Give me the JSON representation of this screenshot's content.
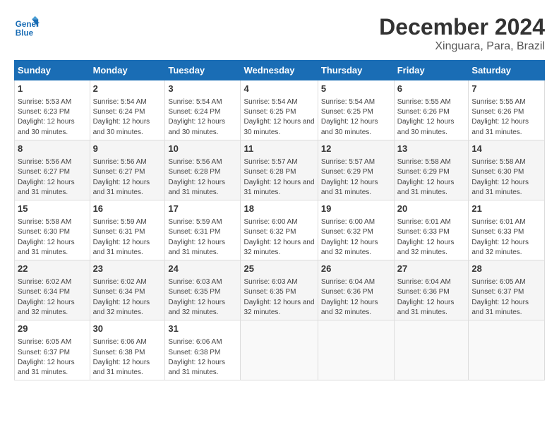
{
  "header": {
    "logo_line1": "General",
    "logo_line2": "Blue",
    "month": "December 2024",
    "location": "Xinguara, Para, Brazil"
  },
  "columns": [
    "Sunday",
    "Monday",
    "Tuesday",
    "Wednesday",
    "Thursday",
    "Friday",
    "Saturday"
  ],
  "weeks": [
    [
      {
        "day": "1",
        "sunrise": "5:53 AM",
        "sunset": "6:23 PM",
        "daylight": "12 hours and 30 minutes."
      },
      {
        "day": "2",
        "sunrise": "5:54 AM",
        "sunset": "6:24 PM",
        "daylight": "12 hours and 30 minutes."
      },
      {
        "day": "3",
        "sunrise": "5:54 AM",
        "sunset": "6:24 PM",
        "daylight": "12 hours and 30 minutes."
      },
      {
        "day": "4",
        "sunrise": "5:54 AM",
        "sunset": "6:25 PM",
        "daylight": "12 hours and 30 minutes."
      },
      {
        "day": "5",
        "sunrise": "5:54 AM",
        "sunset": "6:25 PM",
        "daylight": "12 hours and 30 minutes."
      },
      {
        "day": "6",
        "sunrise": "5:55 AM",
        "sunset": "6:26 PM",
        "daylight": "12 hours and 30 minutes."
      },
      {
        "day": "7",
        "sunrise": "5:55 AM",
        "sunset": "6:26 PM",
        "daylight": "12 hours and 31 minutes."
      }
    ],
    [
      {
        "day": "8",
        "sunrise": "5:56 AM",
        "sunset": "6:27 PM",
        "daylight": "12 hours and 31 minutes."
      },
      {
        "day": "9",
        "sunrise": "5:56 AM",
        "sunset": "6:27 PM",
        "daylight": "12 hours and 31 minutes."
      },
      {
        "day": "10",
        "sunrise": "5:56 AM",
        "sunset": "6:28 PM",
        "daylight": "12 hours and 31 minutes."
      },
      {
        "day": "11",
        "sunrise": "5:57 AM",
        "sunset": "6:28 PM",
        "daylight": "12 hours and 31 minutes."
      },
      {
        "day": "12",
        "sunrise": "5:57 AM",
        "sunset": "6:29 PM",
        "daylight": "12 hours and 31 minutes."
      },
      {
        "day": "13",
        "sunrise": "5:58 AM",
        "sunset": "6:29 PM",
        "daylight": "12 hours and 31 minutes."
      },
      {
        "day": "14",
        "sunrise": "5:58 AM",
        "sunset": "6:30 PM",
        "daylight": "12 hours and 31 minutes."
      }
    ],
    [
      {
        "day": "15",
        "sunrise": "5:58 AM",
        "sunset": "6:30 PM",
        "daylight": "12 hours and 31 minutes."
      },
      {
        "day": "16",
        "sunrise": "5:59 AM",
        "sunset": "6:31 PM",
        "daylight": "12 hours and 31 minutes."
      },
      {
        "day": "17",
        "sunrise": "5:59 AM",
        "sunset": "6:31 PM",
        "daylight": "12 hours and 31 minutes."
      },
      {
        "day": "18",
        "sunrise": "6:00 AM",
        "sunset": "6:32 PM",
        "daylight": "12 hours and 32 minutes."
      },
      {
        "day": "19",
        "sunrise": "6:00 AM",
        "sunset": "6:32 PM",
        "daylight": "12 hours and 32 minutes."
      },
      {
        "day": "20",
        "sunrise": "6:01 AM",
        "sunset": "6:33 PM",
        "daylight": "12 hours and 32 minutes."
      },
      {
        "day": "21",
        "sunrise": "6:01 AM",
        "sunset": "6:33 PM",
        "daylight": "12 hours and 32 minutes."
      }
    ],
    [
      {
        "day": "22",
        "sunrise": "6:02 AM",
        "sunset": "6:34 PM",
        "daylight": "12 hours and 32 minutes."
      },
      {
        "day": "23",
        "sunrise": "6:02 AM",
        "sunset": "6:34 PM",
        "daylight": "12 hours and 32 minutes."
      },
      {
        "day": "24",
        "sunrise": "6:03 AM",
        "sunset": "6:35 PM",
        "daylight": "12 hours and 32 minutes."
      },
      {
        "day": "25",
        "sunrise": "6:03 AM",
        "sunset": "6:35 PM",
        "daylight": "12 hours and 32 minutes."
      },
      {
        "day": "26",
        "sunrise": "6:04 AM",
        "sunset": "6:36 PM",
        "daylight": "12 hours and 32 minutes."
      },
      {
        "day": "27",
        "sunrise": "6:04 AM",
        "sunset": "6:36 PM",
        "daylight": "12 hours and 31 minutes."
      },
      {
        "day": "28",
        "sunrise": "6:05 AM",
        "sunset": "6:37 PM",
        "daylight": "12 hours and 31 minutes."
      }
    ],
    [
      {
        "day": "29",
        "sunrise": "6:05 AM",
        "sunset": "6:37 PM",
        "daylight": "12 hours and 31 minutes."
      },
      {
        "day": "30",
        "sunrise": "6:06 AM",
        "sunset": "6:38 PM",
        "daylight": "12 hours and 31 minutes."
      },
      {
        "day": "31",
        "sunrise": "6:06 AM",
        "sunset": "6:38 PM",
        "daylight": "12 hours and 31 minutes."
      },
      null,
      null,
      null,
      null
    ]
  ]
}
